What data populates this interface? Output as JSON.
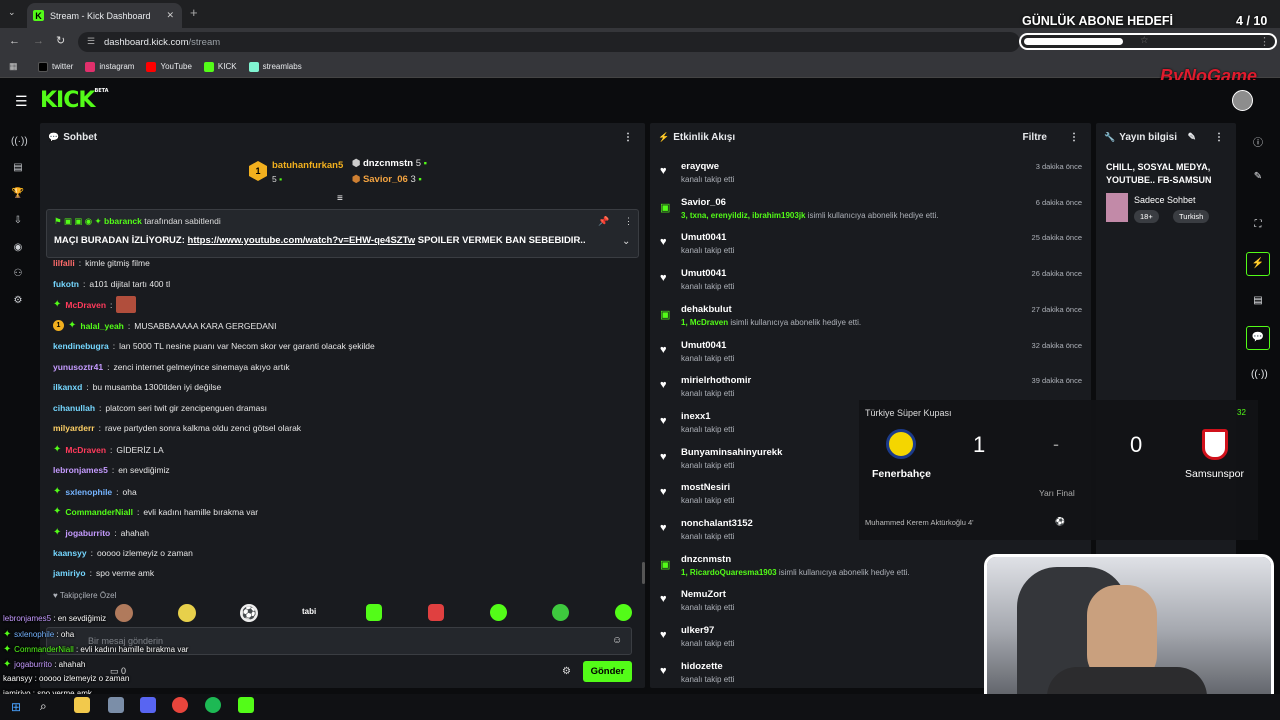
{
  "browser": {
    "tab_title": "Stream - Kick Dashboard",
    "url_host": "dashboard.kick.com",
    "url_path": "/stream",
    "bookmarks": [
      {
        "label": "twitter",
        "color": "#000000"
      },
      {
        "label": "instagram",
        "color": "#e1306c"
      },
      {
        "label": "YouTube",
        "color": "#ff0000"
      },
      {
        "label": "KICK",
        "color": "#53fc18"
      },
      {
        "label": "streamlabs",
        "color": "#80f5d2"
      }
    ]
  },
  "overlay_goal": {
    "title": "GÜNLÜK ABONE HEDEFİ",
    "count": "4",
    "total": "/ 10",
    "progress": 0.4
  },
  "overlay_brand": "ByNoGame",
  "kick": {
    "logo": "KICK",
    "beta": "BETA"
  },
  "chat": {
    "title": "Sohbet",
    "top_gifters": [
      {
        "rank": "1",
        "name": "batuhanfurkan5",
        "count": "5"
      },
      {
        "name": "dnzcnmstn",
        "count": "5"
      },
      {
        "name": "Savior_06",
        "count": "3"
      }
    ],
    "pinned": {
      "pinned_by": "bbaranck",
      "pinned_suffix": "tarafından sabitlendi",
      "text_prefix": "MAÇI BURADAN İZLİYORUZ:",
      "link": "https://www.youtube.com/watch?v=EHW-qe4SZTw",
      "text_suffix": "SPOILER VERMEK BAN SEBEBIDIR.."
    },
    "messages": [
      {
        "user": "lilfalli",
        "color": "#ff6b6b",
        "text": "kimle gitmiş filme"
      },
      {
        "user": "fukotn",
        "color": "#75d7ff",
        "text": "a101 dijital tartı 400 tl"
      },
      {
        "user": "McDraven",
        "color": "#ff3b5c",
        "text": ""
      },
      {
        "user": "halal_yeah",
        "color": "#53fc18",
        "text": "MUSABBAAAAA KARA GERGEDANI"
      },
      {
        "user": "kendinebugra",
        "color": "#75d7ff",
        "text": "lan 5000 TL nesine puanı var Necom skor ver garanti olacak şekilde"
      },
      {
        "user": "yunusoztr41",
        "color": "#c59bff",
        "text": "zenci internet gelmeyince sinemaya akıyo artık"
      },
      {
        "user": "ilkanxd",
        "color": "#75d7ff",
        "text": "bu musamba 1300tlden iyi değilse"
      },
      {
        "user": "cihanullah",
        "color": "#75d7ff",
        "text": "platcorn seri twit gir zencipenguen draması"
      },
      {
        "user": "milyarderr",
        "color": "#ffd166",
        "text": "rave partyden sonra kalkma oldu zenci götsel olarak"
      },
      {
        "user": "McDraven",
        "color": "#ff3b5c",
        "text": "GİDERİZ LA"
      },
      {
        "user": "lebronjames5",
        "color": "#c59bff",
        "text": "en sevdiğimiz"
      },
      {
        "user": "sxlenophile",
        "color": "#75b4ff",
        "text": "oha"
      },
      {
        "user": "CommanderNiall",
        "color": "#53fc18",
        "text": "evli kadını hamille bırakma var"
      },
      {
        "user": "jogaburrito",
        "color": "#c59bff",
        "text": "ahahah"
      },
      {
        "user": "kaansyy",
        "color": "#75d7ff",
        "text": "ooooo izlemeyiz o zaman"
      },
      {
        "user": "jamiriyo",
        "color": "#75d7ff",
        "text": "spo verme amk"
      }
    ],
    "followers_only": "Takipçilere Özel",
    "input_placeholder": "Bir mesaj gönderin",
    "send_label": "Gönder",
    "points_label": "0"
  },
  "activity": {
    "title": "Etkinlik Akışı",
    "filter_label": "Filtre",
    "events": [
      {
        "type": "follow",
        "name": "erayqwe",
        "sub": "kanalı takip etti",
        "highlight": "",
        "time": "3 dakika önce"
      },
      {
        "type": "gift",
        "name": "Savior_06",
        "sub": "isimli kullanıcıya abonelik hediye etti.",
        "highlight": "3, txna, erenyildiz, ibrahim1903jk",
        "time": "6 dakika önce"
      },
      {
        "type": "follow",
        "name": "Umut0041",
        "sub": "kanalı takip etti",
        "highlight": "",
        "time": "25 dakika önce"
      },
      {
        "type": "follow",
        "name": "Umut0041",
        "sub": "kanalı takip etti",
        "highlight": "",
        "time": "26 dakika önce"
      },
      {
        "type": "gift",
        "name": "dehakbulut",
        "sub": "isimli kullanıcıya abonelik hediye etti.",
        "highlight": "1, McDraven",
        "time": "27 dakika önce"
      },
      {
        "type": "follow",
        "name": "Umut0041",
        "sub": "kanalı takip etti",
        "highlight": "",
        "time": "32 dakika önce"
      },
      {
        "type": "follow",
        "name": "mirielrhothomir",
        "sub": "kanalı takip etti",
        "highlight": "",
        "time": "39 dakika önce"
      },
      {
        "type": "follow",
        "name": "inexx1",
        "sub": "kanalı takip etti",
        "highlight": "",
        "time": ""
      },
      {
        "type": "follow",
        "name": "Bunyaminsahinyurekk",
        "sub": "kanalı takip etti",
        "highlight": "",
        "time": ""
      },
      {
        "type": "follow",
        "name": "mostNesiri",
        "sub": "kanalı takip etti",
        "highlight": "",
        "time": ""
      },
      {
        "type": "follow",
        "name": "nonchalant3152",
        "sub": "kanalı takip etti",
        "highlight": "",
        "time": ""
      },
      {
        "type": "gift",
        "name": "dnzcnmstn",
        "sub": "isimli kullanıcıya abonelik hediye etti.",
        "highlight": "1, RicardoQuaresma1903",
        "time": ""
      },
      {
        "type": "follow",
        "name": "NemuZort",
        "sub": "kanalı takip etti",
        "highlight": "",
        "time": ""
      },
      {
        "type": "follow",
        "name": "ulker97",
        "sub": "kanalı takip etti",
        "highlight": "",
        "time": ""
      },
      {
        "type": "follow",
        "name": "hidozette",
        "sub": "kanalı takip etti",
        "highlight": "",
        "time": ""
      }
    ]
  },
  "stream_info": {
    "title": "Yayın bilgisi",
    "stream_title": "CHILL, SOSYAL MEDYA, YOUTUBE.. FB-SAMSUN",
    "category": "Sadece Sohbet",
    "tags": [
      "18+",
      "Turkish"
    ]
  },
  "score": {
    "competition": "Türkiye Süper Kupası",
    "home_team": "Fenerbahçe",
    "away_team": "Samsunspor",
    "home_score": "1",
    "separator": "-",
    "away_score": "0",
    "stage": "Yarı Final",
    "event": "Muhammed Kerem Aktürkoğlu 4'",
    "badge": "32"
  },
  "overlay_chat": [
    {
      "user": "lebronjames5",
      "color": "#c59bff",
      "text": "en sevdiğimiz"
    },
    {
      "user": "sxlenophile",
      "color": "#75b4ff",
      "text": "oha"
    },
    {
      "user": "CommanderNiall",
      "color": "#53fc18",
      "text": "evli kadını hamille bırakma var"
    },
    {
      "user": "jogaburrito",
      "color": "#c59bff",
      "text": "ahahah"
    },
    {
      "user": "kaansyy",
      "color": "#ffffff",
      "text": "ooooo izlemeyiz o zaman"
    },
    {
      "user": "jamiriyo",
      "color": "#ffffff",
      "text": "spo verme amk"
    }
  ]
}
